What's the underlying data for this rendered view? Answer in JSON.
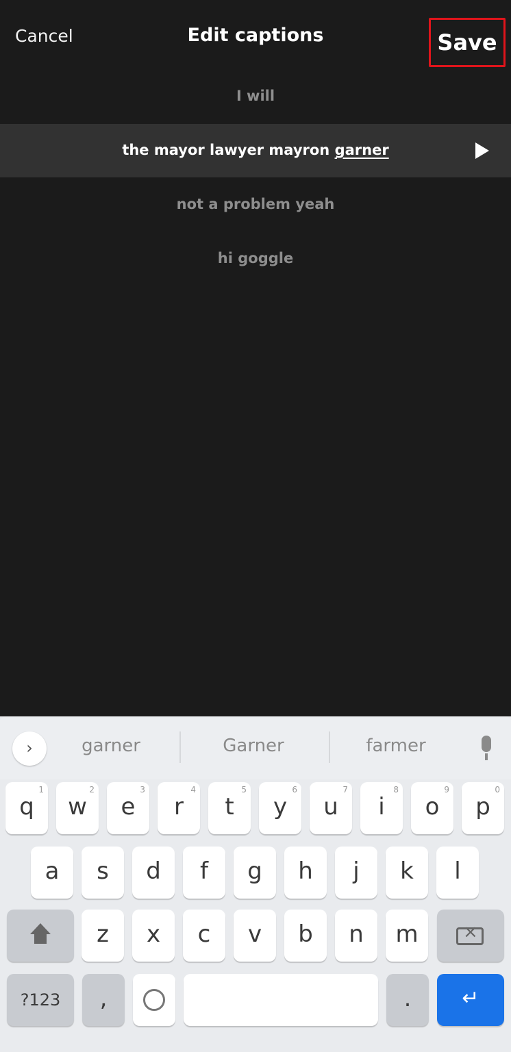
{
  "header": {
    "cancel_label": "Cancel",
    "title": "Edit captions",
    "save_label": "Save",
    "save_highlight_color": "#e0141b"
  },
  "captions": {
    "line1": "I will",
    "active_prefix": "the mayor lawyer mayron ",
    "active_underlined": "garner",
    "line3": "not a problem yeah",
    "line4": "hi goggle"
  },
  "keyboard": {
    "suggestions": [
      "garner",
      "Garner",
      "farmer"
    ],
    "expand_icon": "chevron-right-icon",
    "mic_icon": "mic-icon",
    "row1": [
      "q",
      "w",
      "e",
      "r",
      "t",
      "y",
      "u",
      "i",
      "o",
      "p"
    ],
    "row1_hints": [
      "1",
      "2",
      "3",
      "4",
      "5",
      "6",
      "7",
      "8",
      "9",
      "0"
    ],
    "row2": [
      "a",
      "s",
      "d",
      "f",
      "g",
      "h",
      "j",
      "k",
      "l"
    ],
    "row3": [
      "z",
      "x",
      "c",
      "v",
      "b",
      "n",
      "m"
    ],
    "symbols_label": "?123",
    "period_label": ".",
    "comma_label": ",",
    "enter_icon": "↵",
    "enter_color": "#1a73e8"
  }
}
